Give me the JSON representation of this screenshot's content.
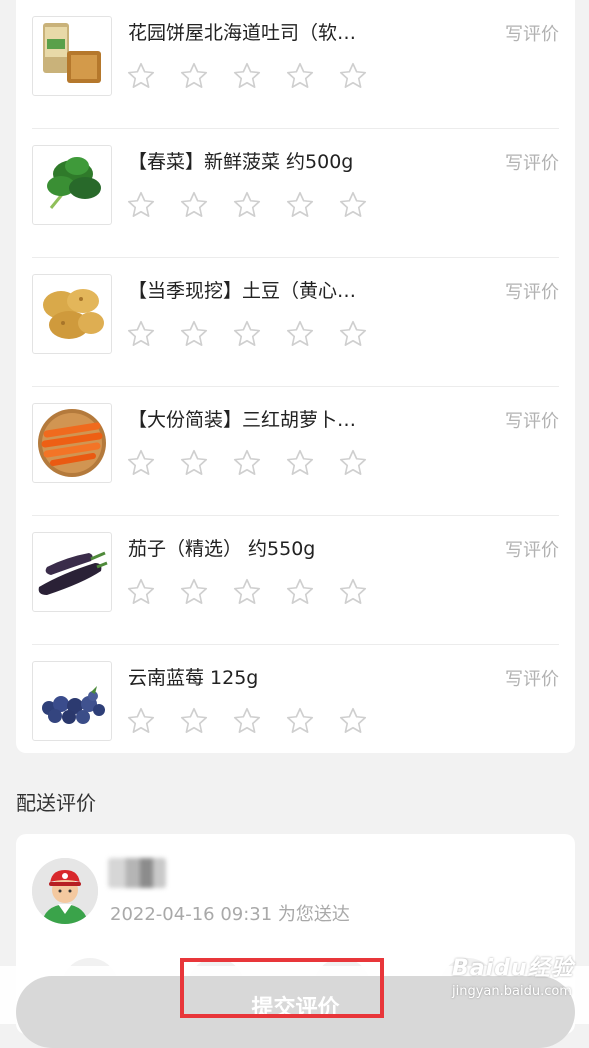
{
  "products": [
    {
      "name": "花园饼屋北海道吐司（软…",
      "review_label": "写评价",
      "rating": 0,
      "thumb_icon": "toast-bread-icon"
    },
    {
      "name": "【春菜】新鲜菠菜 约500g",
      "review_label": "写评价",
      "rating": 0,
      "thumb_icon": "spinach-icon"
    },
    {
      "name": "【当季现挖】土豆（黄心…",
      "review_label": "写评价",
      "rating": 0,
      "thumb_icon": "potato-icon"
    },
    {
      "name": "【大份简装】三红胡萝卜…",
      "review_label": "写评价",
      "rating": 0,
      "thumb_icon": "carrot-icon"
    },
    {
      "name": "茄子（精选） 约550g",
      "review_label": "写评价",
      "rating": 0,
      "thumb_icon": "eggplant-icon"
    },
    {
      "name": "云南蓝莓 125g",
      "review_label": "写评价",
      "rating": 0,
      "thumb_icon": "blueberry-icon"
    }
  ],
  "delivery": {
    "section_title": "配送评价",
    "time_text": "2022-04-16 09:31 为您送达",
    "courier_avatar_icon": "courier-avatar-icon"
  },
  "submit": {
    "label": "提交评价"
  },
  "watermark": {
    "logo": "Baidu经验",
    "url": "jingyan.baidu.com"
  },
  "colors": {
    "accent_highlight": "#e8363a",
    "muted_text": "#b2b2b2",
    "button_disabled": "#d8d8d8"
  }
}
